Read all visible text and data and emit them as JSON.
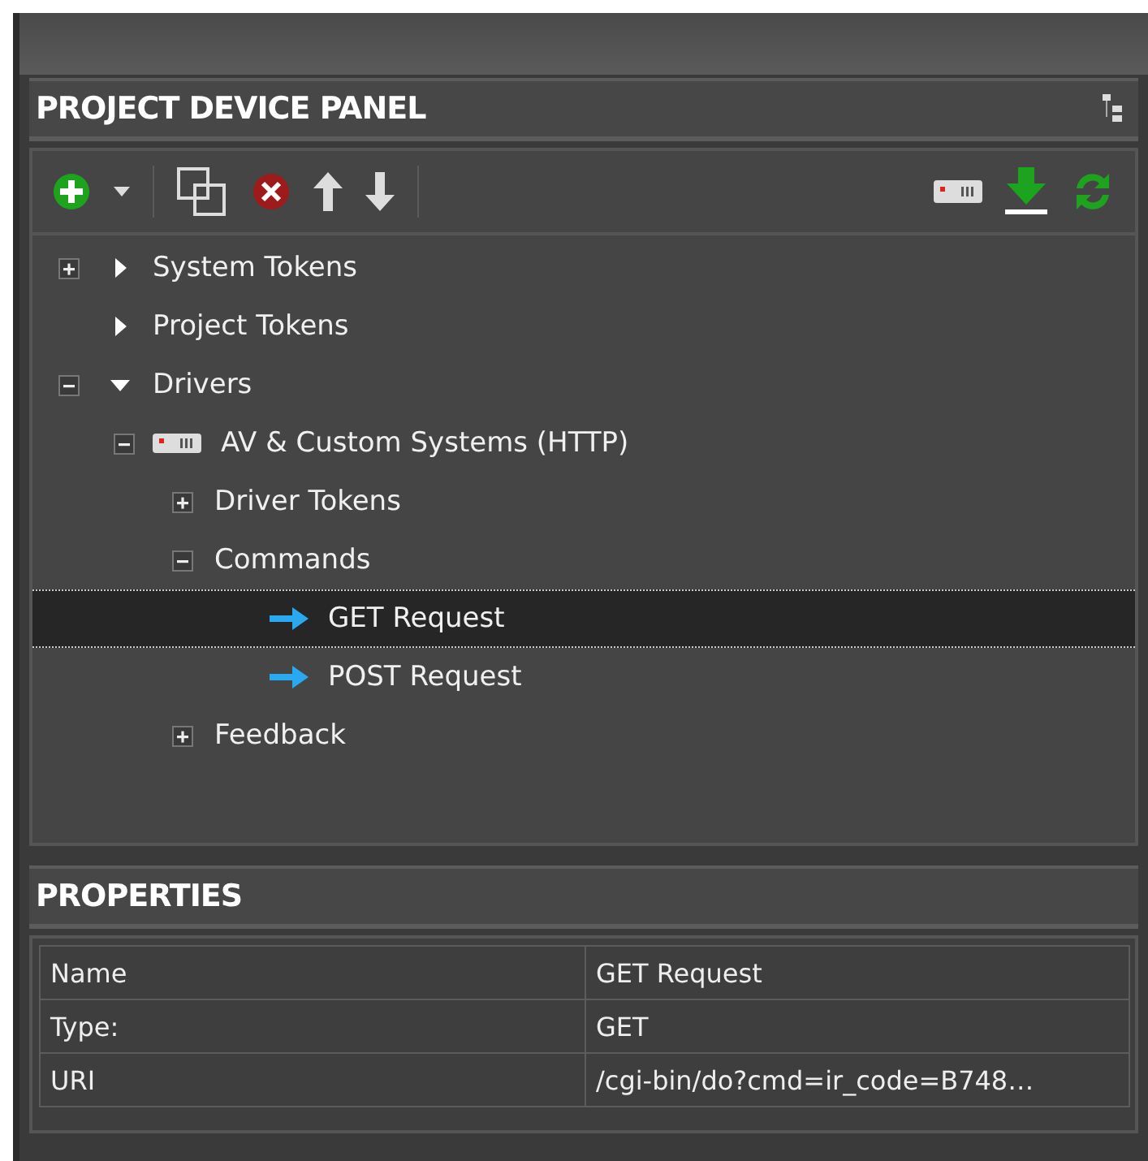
{
  "device_panel": {
    "title": "PROJECT DEVICE PANEL",
    "tree": [
      {
        "label": "System Tokens",
        "kind": "category",
        "expandable": true,
        "expanded": false,
        "selected": false
      },
      {
        "label": "Project Tokens",
        "kind": "category",
        "expandable": false,
        "expanded": false,
        "selected": false
      },
      {
        "label": "Drivers",
        "kind": "category",
        "expandable": true,
        "expanded": true,
        "selected": false,
        "children": [
          {
            "label": "AV & Custom Systems (HTTP)",
            "kind": "device",
            "expandable": true,
            "expanded": true,
            "selected": false,
            "children": [
              {
                "label": "Driver Tokens",
                "kind": "folder",
                "expandable": true,
                "expanded": false,
                "selected": false
              },
              {
                "label": "Commands",
                "kind": "folder",
                "expandable": true,
                "expanded": true,
                "selected": false,
                "children": [
                  {
                    "label": "GET Request",
                    "kind": "command",
                    "selected": true
                  },
                  {
                    "label": "POST Request",
                    "kind": "command",
                    "selected": false
                  }
                ]
              },
              {
                "label": "Feedback",
                "kind": "folder",
                "expandable": true,
                "expanded": false,
                "selected": false
              }
            ]
          }
        ]
      }
    ]
  },
  "properties": {
    "title": "PROPERTIES",
    "rows": [
      {
        "name": "Name",
        "value": "GET Request"
      },
      {
        "name": "Type:",
        "value": "GET"
      },
      {
        "name": "URI",
        "value": "/cgi-bin/do?cmd=ir_code=B748…"
      }
    ]
  }
}
